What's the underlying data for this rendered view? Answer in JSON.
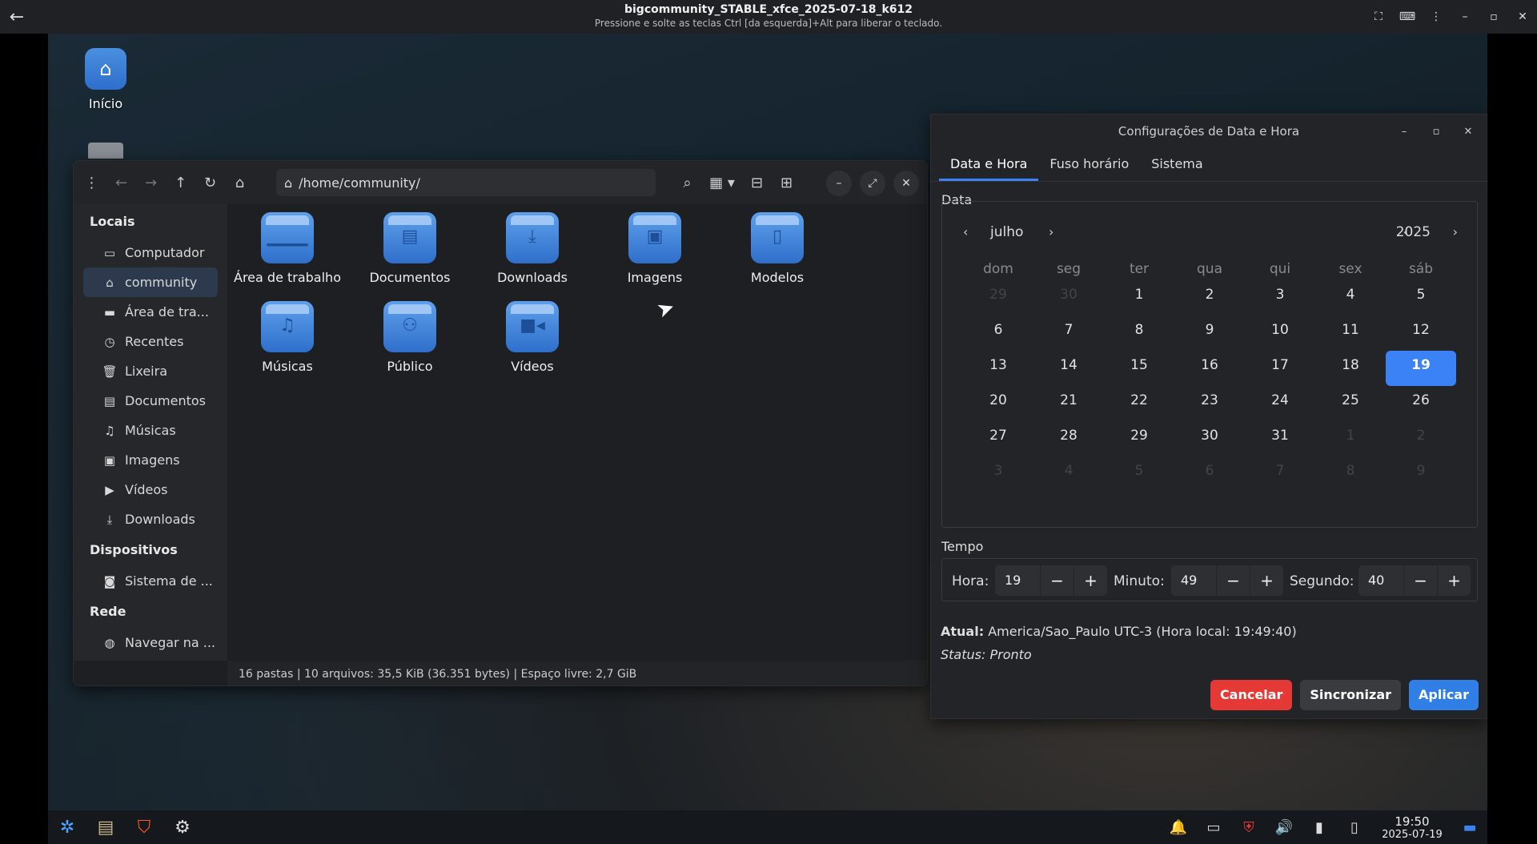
{
  "host": {
    "title": "bigcommunity_STABLE_xfce_2025-07-18_k612",
    "hint": "Pressione e solte as teclas Ctrl [da esquerda]+Alt para liberar o teclado.",
    "back_icon": "back-arrow-icon"
  },
  "desktop": {
    "icons": [
      {
        "label": "Início"
      }
    ]
  },
  "file_manager": {
    "path": "/home/community/",
    "sidebar": {
      "sections": [
        {
          "title": "Locais",
          "items": [
            {
              "label": "Computador",
              "icon": "monitor-icon"
            },
            {
              "label": "community",
              "icon": "home-icon",
              "active": true
            },
            {
              "label": "Área de tra...",
              "icon": "desktop-icon"
            },
            {
              "label": "Recentes",
              "icon": "clock-icon"
            },
            {
              "label": "Lixeira",
              "icon": "trash-icon"
            },
            {
              "label": "Documentos",
              "icon": "document-icon"
            },
            {
              "label": "Músicas",
              "icon": "music-icon"
            },
            {
              "label": "Imagens",
              "icon": "image-icon"
            },
            {
              "label": "Vídeos",
              "icon": "video-icon"
            },
            {
              "label": "Downloads",
              "icon": "download-icon"
            }
          ]
        },
        {
          "title": "Dispositivos",
          "items": [
            {
              "label": "Sistema de ...",
              "icon": "drive-icon"
            }
          ]
        },
        {
          "title": "Rede",
          "items": [
            {
              "label": "Navegar na ...",
              "icon": "network-icon"
            }
          ]
        }
      ]
    },
    "folders": [
      {
        "label": "Área de trabalho",
        "icon": "desktop-folder-icon"
      },
      {
        "label": "Documentos",
        "icon": "documents-folder-icon"
      },
      {
        "label": "Downloads",
        "icon": "downloads-folder-icon"
      },
      {
        "label": "Imagens",
        "icon": "pictures-folder-icon"
      },
      {
        "label": "Modelos",
        "icon": "templates-folder-icon"
      },
      {
        "label": "Músicas",
        "icon": "music-folder-icon"
      },
      {
        "label": "Público",
        "icon": "public-folder-icon"
      },
      {
        "label": "Vídeos",
        "icon": "videos-folder-icon"
      }
    ],
    "status": "16 pastas  |  10 arquivos: 35,5 KiB (36.351 bytes)  |  Espaço livre: 2,7 GiB"
  },
  "datetime": {
    "title": "Configurações de Data e Hora",
    "tabs": [
      "Data e Hora",
      "Fuso horário",
      "Sistema"
    ],
    "active_tab": "Data e Hora",
    "date_section": "Data",
    "month": "julho",
    "year": "2025",
    "weekdays": [
      "dom",
      "seg",
      "ter",
      "qua",
      "qui",
      "sex",
      "sáb"
    ],
    "weeks": [
      [
        "29",
        "30",
        "1",
        "2",
        "3",
        "4",
        "5"
      ],
      [
        "6",
        "7",
        "8",
        "9",
        "10",
        "11",
        "12"
      ],
      [
        "13",
        "14",
        "15",
        "16",
        "17",
        "18",
        "19"
      ],
      [
        "20",
        "21",
        "22",
        "23",
        "24",
        "25",
        "26"
      ],
      [
        "27",
        "28",
        "29",
        "30",
        "31",
        "1",
        "2"
      ],
      [
        "3",
        "4",
        "5",
        "6",
        "7",
        "8",
        "9"
      ]
    ],
    "selected_day": "19",
    "time_section": "Tempo",
    "hour_label": "Hora:",
    "hour": "19",
    "minute_label": "Minuto:",
    "minute": "49",
    "second_label": "Segundo:",
    "second": "40",
    "current_label": "Atual:",
    "current_value": "America/Sao_Paulo UTC-3 (Hora local: 19:49:40)",
    "status": "Status: Pronto",
    "buttons": {
      "cancel": "Cancelar",
      "sync": "Sincronizar",
      "apply": "Aplicar"
    },
    "colors": {
      "accent": "#3b82f6",
      "cancel": "#e53935",
      "apply": "#2f7fe6"
    }
  },
  "taskbar": {
    "time": "19:50",
    "date": "2025-07-19"
  }
}
